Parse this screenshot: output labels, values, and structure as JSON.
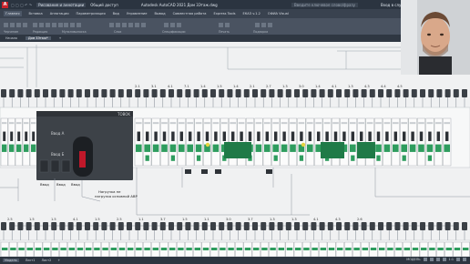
{
  "window": {
    "title": "Autodesk AutoCAD 2021  Дом 3Этаж.dwg",
    "search_placeholder": "Введите ключевое слово/фразу",
    "signin": "Вход в службы",
    "quick": "Рисование и аннотации",
    "share": "Общий доступ"
  },
  "menu": {
    "items": [
      "Главная",
      "Вставка",
      "Аннотации",
      "Параметризация",
      "Вид",
      "Управление",
      "Вывод",
      "Совместная работа",
      "Express Tools",
      "ЕКАЗ v.1.2",
      "ОФИА Visual"
    ]
  },
  "ribbon": {
    "groups": [
      "Построение",
      "Подрезка",
      "Слои",
      "Свойства",
      "Блоки",
      "Утилиты"
    ],
    "labels": [
      "Черчение",
      "Редакция",
      "Мультивыноска",
      "Слои",
      "Спецификации",
      "Печать",
      "Подзорка"
    ]
  },
  "tabs": {
    "items": [
      "Начало",
      "Дом 3Этаж*",
      "+"
    ],
    "active": 1
  },
  "drawing": {
    "ats_brand": "TOBOK",
    "ats_label_a": "Ввод А",
    "ats_label_b": "Ввод Б",
    "annotation": "Нагрузка не\nнагрузка основной АВР",
    "top_circuit_labels": [
      "2.1",
      "3.1",
      "4.1",
      "7.1",
      "1.4",
      "1.5",
      "1.4",
      "2.1",
      "2.7",
      "1.3",
      "3.0",
      "1.4",
      "4.1",
      "1.3",
      "4.3",
      "4.4",
      "4.5"
    ],
    "bottom_circuit_labels": [
      "2.5",
      "1.5",
      "1.5",
      "4.1",
      "1.5",
      "2.5",
      "1.1",
      "3.7",
      "1.5",
      "1.1",
      "3.0",
      "3.7",
      "1.3",
      "1.3",
      "4.1",
      "4.3",
      "2.6"
    ],
    "breaker_rating": "IEK",
    "vvod_labels": [
      "Ввод",
      "Ввод",
      "Ввод"
    ]
  },
  "statusbar": {
    "tabs": [
      "Модель",
      "Лист1",
      "Лист2",
      "+"
    ],
    "mode": "МОДЕЛЬ",
    "scale": "1:1"
  },
  "colors": {
    "breaker_green": "#2e9c5e",
    "ats_body": "#3d4248",
    "ats_led": "#c0182a",
    "titlebar": "#2b3440"
  }
}
